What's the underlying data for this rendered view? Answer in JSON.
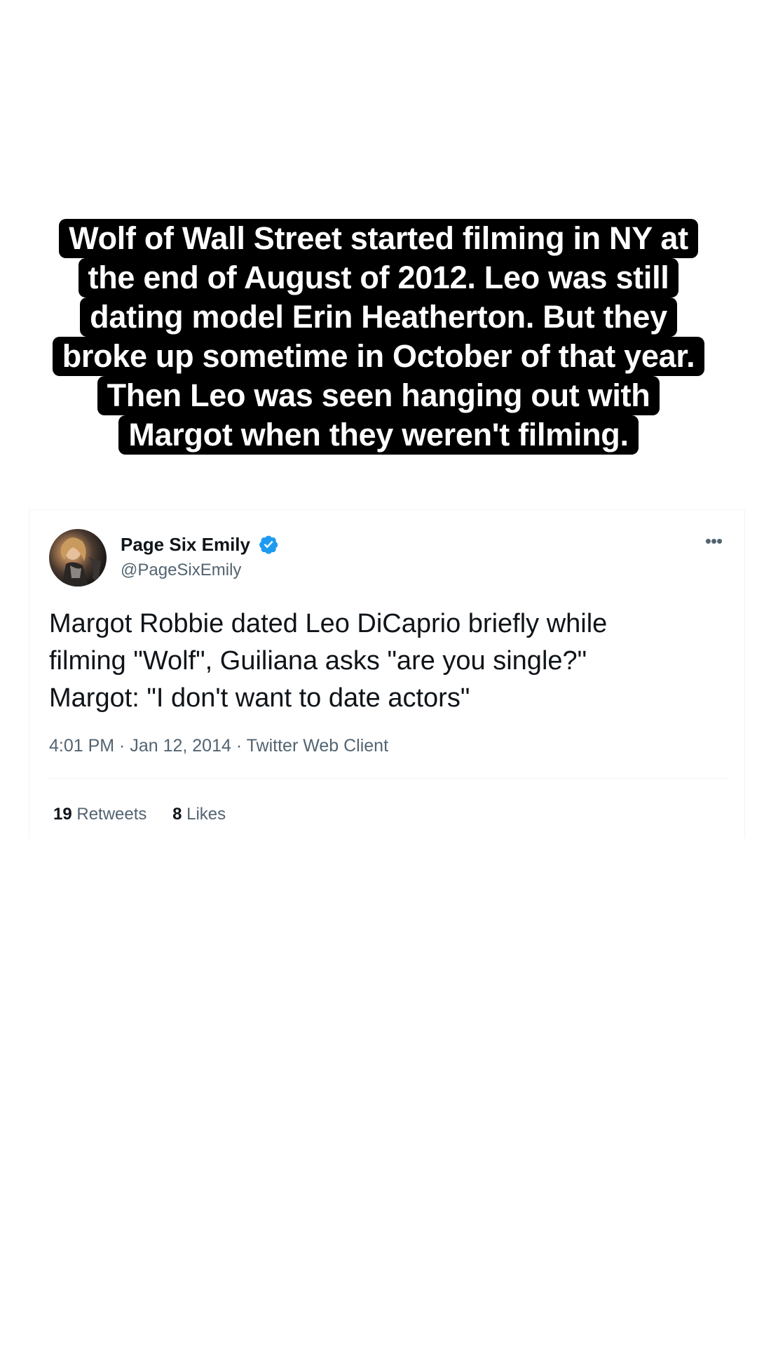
{
  "caption": {
    "lines": [
      "Wolf of Wall Street started filming in NY at",
      "the end of August of 2012. Leo was still",
      "dating model Erin Heatherton. But they",
      "broke up sometime in October of that year.",
      "Then Leo was seen hanging out with",
      "Margot when they weren't filming."
    ]
  },
  "tweet": {
    "author_name": "Page Six Emily",
    "author_handle": "@PageSixEmily",
    "verified": true,
    "text_lines": [
      "Margot Robbie dated Leo DiCaprio briefly while",
      "filming \"Wolf\", Guiliana asks \"are you single?\"",
      "Margot: \"I don't want to date actors\""
    ],
    "meta": "4:01 PM · Jan 12, 2014 · Twitter Web Client",
    "retweets_count": "19",
    "retweets_label": "Retweets",
    "likes_count": "8",
    "likes_label": "Likes",
    "more_icon": "more-horizontal-icon",
    "verified_color": "#1d9bf0"
  }
}
